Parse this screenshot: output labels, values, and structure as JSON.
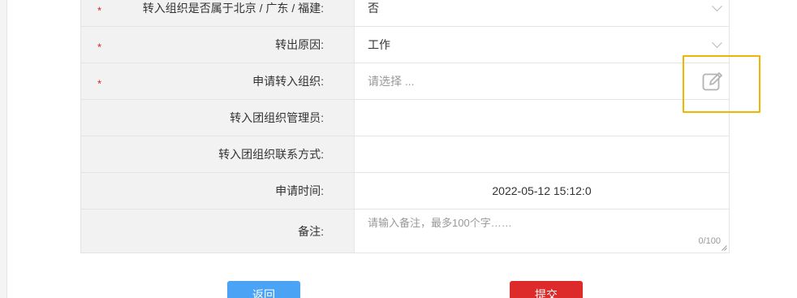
{
  "form": {
    "rows": [
      {
        "label": "转入组织是否属于北京 / 广东 / 福建:",
        "required": true,
        "value": "否"
      },
      {
        "label": "转出原因:",
        "required": true,
        "value": "工作"
      },
      {
        "label": "申请转入组织:",
        "required": true,
        "placeholder": "请选择 ..."
      },
      {
        "label": "转入团组织管理员:",
        "required": false,
        "value": ""
      },
      {
        "label": "转入团组织联系方式:",
        "required": false,
        "value": ""
      },
      {
        "label": "申请时间:",
        "required": false,
        "value": "2022-05-12 15:12:0"
      },
      {
        "label": "备注:",
        "required": false,
        "placeholder": "请输入备注，最多100个字……",
        "counter": "0/100"
      }
    ],
    "required_mark": "*"
  },
  "buttons": {
    "back_label": "返回",
    "submit_label": "提交"
  },
  "icons": {
    "edit": "edit-icon",
    "chevron": "chevron-down-icon"
  },
  "colors": {
    "required": "#e02020",
    "highlight": "#f1b500",
    "back_button": "#4aa3f5",
    "submit_button": "#dd2a2a"
  }
}
